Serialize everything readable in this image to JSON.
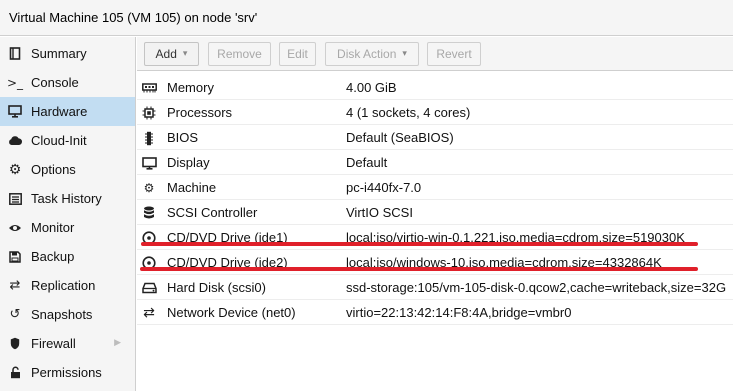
{
  "window": {
    "title": "Virtual Machine 105 (VM 105) on node 'srv'"
  },
  "sidebar": {
    "items": [
      {
        "label": "Summary",
        "icon": "book-icon"
      },
      {
        "label": "Console",
        "icon": "terminal-icon"
      },
      {
        "label": "Hardware",
        "icon": "monitor-icon",
        "active": true
      },
      {
        "label": "Cloud-Init",
        "icon": "cloud-icon"
      },
      {
        "label": "Options",
        "icon": "gear-icon"
      },
      {
        "label": "Task History",
        "icon": "list-icon"
      },
      {
        "label": "Monitor",
        "icon": "eye-icon"
      },
      {
        "label": "Backup",
        "icon": "floppy-icon"
      },
      {
        "label": "Replication",
        "icon": "retweet-icon"
      },
      {
        "label": "Snapshots",
        "icon": "history-icon"
      },
      {
        "label": "Firewall",
        "icon": "shield-icon",
        "expandable": true
      },
      {
        "label": "Permissions",
        "icon": "unlock-icon"
      }
    ]
  },
  "toolbar": {
    "add": "Add",
    "remove": "Remove",
    "edit": "Edit",
    "disk_action": "Disk Action",
    "revert": "Revert"
  },
  "hardware": {
    "rows": [
      {
        "key": "Memory",
        "value": "4.00 GiB",
        "icon": "memory-icon"
      },
      {
        "key": "Processors",
        "value": "4 (1 sockets, 4 cores)",
        "icon": "cpu-icon"
      },
      {
        "key": "BIOS",
        "value": "Default (SeaBIOS)",
        "icon": "chip-icon"
      },
      {
        "key": "Display",
        "value": "Default",
        "icon": "desktop-icon"
      },
      {
        "key": "Machine",
        "value": "pc-i440fx-7.0",
        "icon": "cogs-icon"
      },
      {
        "key": "SCSI Controller",
        "value": "VirtIO SCSI",
        "icon": "database-icon"
      },
      {
        "key": "CD/DVD Drive (ide1)",
        "value": "local:iso/virtio-win-0.1.221.iso,media=cdrom,size=519030K",
        "icon": "cdrom-icon",
        "highlighted": true
      },
      {
        "key": "CD/DVD Drive (ide2)",
        "value": "local:iso/windows-10.iso,media=cdrom,size=4332864K",
        "icon": "cdrom-icon",
        "highlighted": true
      },
      {
        "key": "Hard Disk (scsi0)",
        "value": "ssd-storage:105/vm-105-disk-0.qcow2,cache=writeback,size=32G",
        "icon": "hdd-icon"
      },
      {
        "key": "Network Device (net0)",
        "value": "virtio=22:13:42:14:F8:4A,bridge=vmbr0",
        "icon": "exchange-icon"
      }
    ]
  },
  "colors": {
    "selection": "#c2ddf2",
    "annotation_underline": "#e0202a",
    "panel_background": "#f5f5f5"
  }
}
